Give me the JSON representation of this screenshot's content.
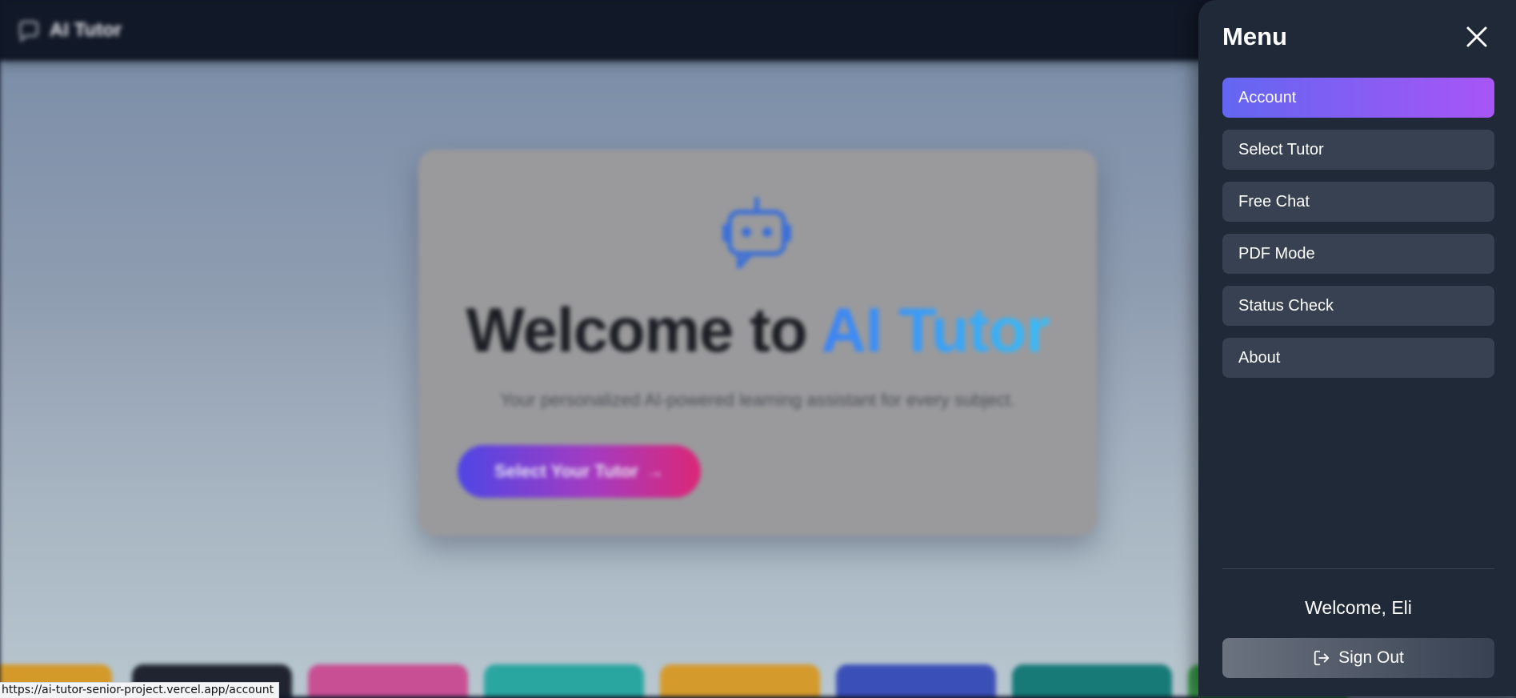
{
  "app": {
    "brand": "AI Tutor"
  },
  "hero": {
    "title_prefix": "Welcome to ",
    "title_accent": "AI Tutor",
    "subtitle": "Your personalized AI-powered learning assistant for every subject.",
    "cta_label": "Select Your Tutor",
    "cta_arrow": "→"
  },
  "menu": {
    "title": "Menu",
    "items": [
      {
        "label": "Account",
        "active": true
      },
      {
        "label": "Select Tutor",
        "active": false
      },
      {
        "label": "Free Chat",
        "active": false
      },
      {
        "label": "PDF Mode",
        "active": false
      },
      {
        "label": "Status Check",
        "active": false
      },
      {
        "label": "About",
        "active": false
      }
    ],
    "welcome": "Welcome, Eli",
    "sign_out": "Sign Out"
  },
  "status_bar": {
    "url": "https://ai-tutor-senior-project.vercel.app/account"
  },
  "colors": {
    "panel_bg": "#1f2937",
    "item_bg": "#374151",
    "active_gradient_start": "#6366f1",
    "active_gradient_end": "#a855f7",
    "accent_blue": "#3b82f6"
  },
  "icons": {
    "brand": "chat-bubble-icon",
    "hero": "robot-icon",
    "close": "close-icon",
    "sign_out": "sign-out-icon"
  }
}
